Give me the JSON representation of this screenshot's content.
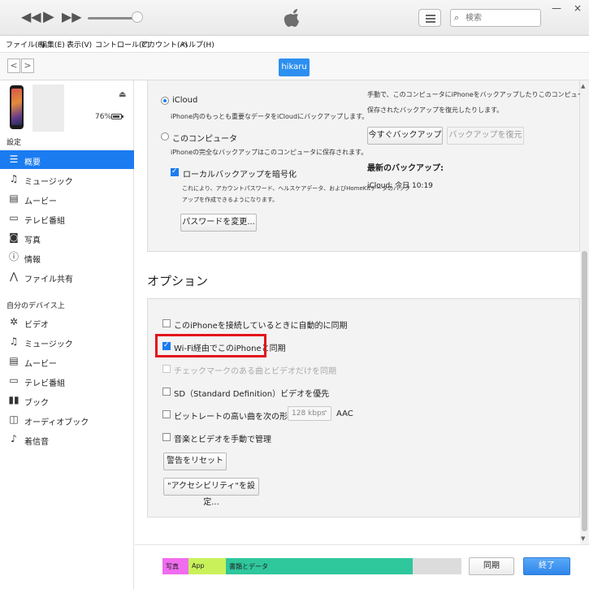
{
  "player": {
    "search_placeholder": "検索",
    "win_min": "—",
    "win_close": "×"
  },
  "menu": [
    "ファイル(F)",
    "編集(E)",
    "表示(V)",
    "コントロール(C)",
    "アカウント(A)",
    "ヘルプ(H)"
  ],
  "nav": {
    "back": "<",
    "forward": ">",
    "device_name": "hikaru"
  },
  "device": {
    "battery": "76%"
  },
  "sidebar": {
    "settings_title": "設定",
    "settings_items": [
      {
        "label": "概要",
        "icon": "summary-icon",
        "active": true
      },
      {
        "label": "ミュージック",
        "icon": "music-icon"
      },
      {
        "label": "ムービー",
        "icon": "film-icon"
      },
      {
        "label": "テレビ番組",
        "icon": "tv-icon"
      },
      {
        "label": "写真",
        "icon": "camera-icon"
      },
      {
        "label": "情報",
        "icon": "info-icon"
      },
      {
        "label": "ファイル共有",
        "icon": "apps-icon"
      }
    ],
    "mydevice_title": "自分のデバイス上",
    "mydevice_items": [
      {
        "label": "ビデオ",
        "icon": "gear-icon"
      },
      {
        "label": "ミュージック",
        "icon": "music-icon"
      },
      {
        "label": "ムービー",
        "icon": "film-icon"
      },
      {
        "label": "テレビ番組",
        "icon": "tv-icon"
      },
      {
        "label": "ブック",
        "icon": "book-icon"
      },
      {
        "label": "オーディオブック",
        "icon": "audiobook-icon"
      },
      {
        "label": "着信音",
        "icon": "bell-icon"
      }
    ]
  },
  "backup": {
    "icloud_label": "iCloud",
    "icloud_desc": "iPhone内のもっとも重要なデータをiCloudにバックアップします。",
    "computer_label": "このコンピュータ",
    "computer_desc": "iPhoneの完全なバックアップはこのコンピュータに保存されます。",
    "encrypt_label": "ローカルバックアップを暗号化",
    "encrypt_desc1": "これにより、アカウントパスワード、ヘルスケアデータ、およびHomeKitデータのバック",
    "encrypt_desc2": "アップを作成できるようになります。",
    "change_pw_button": "パスワードを変更...",
    "manual_desc1": "手動で、このコンピュータにiPhoneをバックアップしたりこのコンピュータに",
    "manual_desc2": "保存されたバックアップを復元したりします。",
    "backup_now_button": "今すぐバックアップ",
    "restore_button": "バックアップを復元",
    "latest_title": "最新のバックアップ:",
    "latest_value": "iCloud: 今日 10:19"
  },
  "options": {
    "title": "オプション",
    "auto_sync": "このiPhoneを接続しているときに自動的に同期",
    "wifi_sync": "Wi-Fi経由でこのiPhoneと同期",
    "checked_only": "チェックマークのある曲とビデオだけを同期",
    "sd_video": "SD（Standard Definition）ビデオを優先",
    "convert_bitrate": "ビットレートの高い曲を次の形式に変換:",
    "bitrate_value": "128 kbps",
    "bitrate_format": "AAC",
    "manual_manage": "音楽とビデオを手動で管理",
    "reset_warnings_button": "警告をリセット",
    "accessibility_button": "\"アクセシビリティ\"を設定..."
  },
  "capacity": {
    "segments": [
      {
        "label": "写真",
        "color": "#f06cf0"
      },
      {
        "label": "App",
        "color": "#c9f25a"
      },
      {
        "label": "書類とデータ",
        "color": "#2fc79c"
      }
    ],
    "sync_button": "同期",
    "done_button": "終了"
  }
}
